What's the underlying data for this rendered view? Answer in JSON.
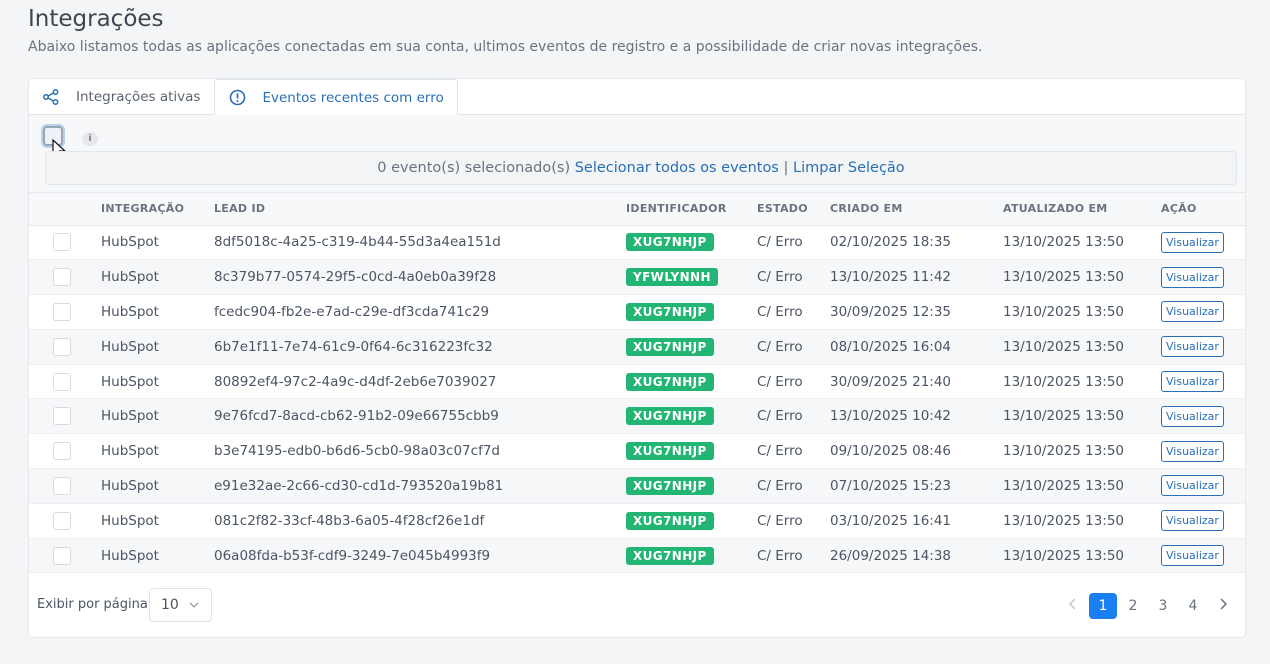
{
  "header": {
    "title": "Integrações",
    "subtitle": "Abaixo listamos todas as aplicações conectadas em sua conta, ultimos eventos de registro e a possibilidade de criar novas integrações."
  },
  "tabs": [
    {
      "label": "Integrações ativas",
      "icon": "share-icon"
    },
    {
      "label": "Eventos recentes com erro",
      "icon": "alert-circle-icon"
    }
  ],
  "selection": {
    "info_icon": "i",
    "count_text": "0 evento(s) selecionado(s)",
    "select_all_label": "Selecionar todos os eventos",
    "separator": "|",
    "clear_label": "Limpar Seleção"
  },
  "table": {
    "columns": [
      "INTEGRAÇÃO",
      "LEAD ID",
      "IDENTIFICADOR",
      "ESTADO",
      "CRIADO EM",
      "ATUALIZADO EM",
      "AÇÃO"
    ],
    "action_label": "Visualizar",
    "rows": [
      {
        "integration": "HubSpot",
        "lead_id": "8df5018c-4a25-c319-4b44-55d3a4ea151d",
        "identifier": "XUG7NHJP",
        "state": "C/ Erro",
        "created": "02/10/2025 18:35",
        "updated": "13/10/2025 13:50"
      },
      {
        "integration": "HubSpot",
        "lead_id": "8c379b77-0574-29f5-c0cd-4a0eb0a39f28",
        "identifier": "YFWLYNNH",
        "state": "C/ Erro",
        "created": "13/10/2025 11:42",
        "updated": "13/10/2025 13:50"
      },
      {
        "integration": "HubSpot",
        "lead_id": "fcedc904-fb2e-e7ad-c29e-df3cda741c29",
        "identifier": "XUG7NHJP",
        "state": "C/ Erro",
        "created": "30/09/2025 12:35",
        "updated": "13/10/2025 13:50"
      },
      {
        "integration": "HubSpot",
        "lead_id": "6b7e1f11-7e74-61c9-0f64-6c316223fc32",
        "identifier": "XUG7NHJP",
        "state": "C/ Erro",
        "created": "08/10/2025 16:04",
        "updated": "13/10/2025 13:50"
      },
      {
        "integration": "HubSpot",
        "lead_id": "80892ef4-97c2-4a9c-d4df-2eb6e7039027",
        "identifier": "XUG7NHJP",
        "state": "C/ Erro",
        "created": "30/09/2025 21:40",
        "updated": "13/10/2025 13:50"
      },
      {
        "integration": "HubSpot",
        "lead_id": "9e76fcd7-8acd-cb62-91b2-09e66755cbb9",
        "identifier": "XUG7NHJP",
        "state": "C/ Erro",
        "created": "13/10/2025 10:42",
        "updated": "13/10/2025 13:50"
      },
      {
        "integration": "HubSpot",
        "lead_id": "b3e74195-edb0-b6d6-5cb0-98a03c07cf7d",
        "identifier": "XUG7NHJP",
        "state": "C/ Erro",
        "created": "09/10/2025 08:46",
        "updated": "13/10/2025 13:50"
      },
      {
        "integration": "HubSpot",
        "lead_id": "e91e32ae-2c66-cd30-cd1d-793520a19b81",
        "identifier": "XUG7NHJP",
        "state": "C/ Erro",
        "created": "07/10/2025 15:23",
        "updated": "13/10/2025 13:50"
      },
      {
        "integration": "HubSpot",
        "lead_id": "081c2f82-33cf-48b3-6a05-4f28cf26e1df",
        "identifier": "XUG7NHJP",
        "state": "C/ Erro",
        "created": "03/10/2025 16:41",
        "updated": "13/10/2025 13:50"
      },
      {
        "integration": "HubSpot",
        "lead_id": "06a08fda-b53f-cdf9-3249-7e045b4993f9",
        "identifier": "XUG7NHJP",
        "state": "C/ Erro",
        "created": "26/09/2025 14:38",
        "updated": "13/10/2025 13:50"
      }
    ]
  },
  "footer": {
    "per_page_label": "Exibir por página",
    "per_page_value": "10",
    "pages": [
      "1",
      "2",
      "3",
      "4"
    ],
    "current_page": "1"
  },
  "colors": {
    "accent": "#1a7ff0",
    "link": "#2a6fb5",
    "badge": "#22b573"
  }
}
